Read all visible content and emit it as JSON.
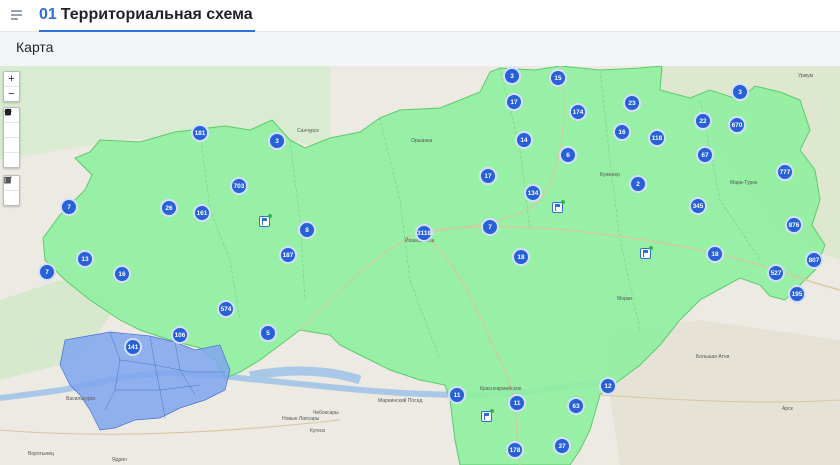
{
  "header": {
    "number": "01",
    "title": "Территориальная схема"
  },
  "subheader": {
    "title": "Карта"
  },
  "icons": {
    "menu": "menu-icon",
    "zoom_in": "plus-icon",
    "zoom_out": "minus-icon",
    "polyline": "line-draw-icon",
    "polygon": "polygon-draw-icon",
    "rectangle": "rectangle-draw-icon",
    "circle": "circle-draw-icon",
    "edit": "edit-icon",
    "delete": "trash-icon"
  },
  "tools": {
    "zoom_in": "+",
    "zoom_out": "−"
  },
  "colors": {
    "accent": "#2d6fdb",
    "region_fill": "#8ff09e",
    "selected_fill": "#7fa6ee",
    "cluster": "#2860d8"
  },
  "clusters": [
    {
      "v": "3"
    },
    {
      "v": "15"
    },
    {
      "v": "17"
    },
    {
      "v": "174"
    },
    {
      "v": "23"
    },
    {
      "v": "3"
    },
    {
      "v": "181"
    },
    {
      "v": "3"
    },
    {
      "v": "14"
    },
    {
      "v": "16"
    },
    {
      "v": "118"
    },
    {
      "v": "22"
    },
    {
      "v": "670"
    },
    {
      "v": "6"
    },
    {
      "v": "67"
    },
    {
      "v": "17"
    },
    {
      "v": "703"
    },
    {
      "v": "134"
    },
    {
      "v": "2"
    },
    {
      "v": "777"
    },
    {
      "v": "7"
    },
    {
      "v": "26"
    },
    {
      "v": "161"
    },
    {
      "v": "345"
    },
    {
      "v": "8"
    },
    {
      "v": "7"
    },
    {
      "v": "3118"
    },
    {
      "v": "876"
    },
    {
      "v": "13"
    },
    {
      "v": "187"
    },
    {
      "v": "18"
    },
    {
      "v": "18"
    },
    {
      "v": "807"
    },
    {
      "v": "7"
    },
    {
      "v": "16"
    },
    {
      "v": "527"
    },
    {
      "v": "195"
    },
    {
      "v": "574"
    },
    {
      "v": "5"
    },
    {
      "v": "106"
    },
    {
      "v": "141"
    },
    {
      "v": "12"
    },
    {
      "v": "11"
    },
    {
      "v": "11"
    },
    {
      "v": "63"
    },
    {
      "v": "178"
    },
    {
      "v": "37"
    }
  ],
  "labels": {
    "sanchursk": "Санчурск",
    "orshanka": "Оршанка",
    "cheboksary": "Чебоксары",
    "mariinsky_posad": "Мариинский Посад",
    "novye_lapsary": "Новые Лапсары",
    "kugesi": "Кугеси",
    "vasilsursk": "Васильсурск",
    "vorotynets": "Воротынец",
    "yadrin": "Ядрин",
    "krasnookt": "Красноармейское",
    "urzhum": "Уржум",
    "arsk": "Арск",
    "bolshaya_atnya": "Большая Атня",
    "mari_turek": "Мари-Турек",
    "kuzhener": "Куженер",
    "morki": "Морки",
    "yoshkar_ola": "Йошкар-Ола"
  }
}
